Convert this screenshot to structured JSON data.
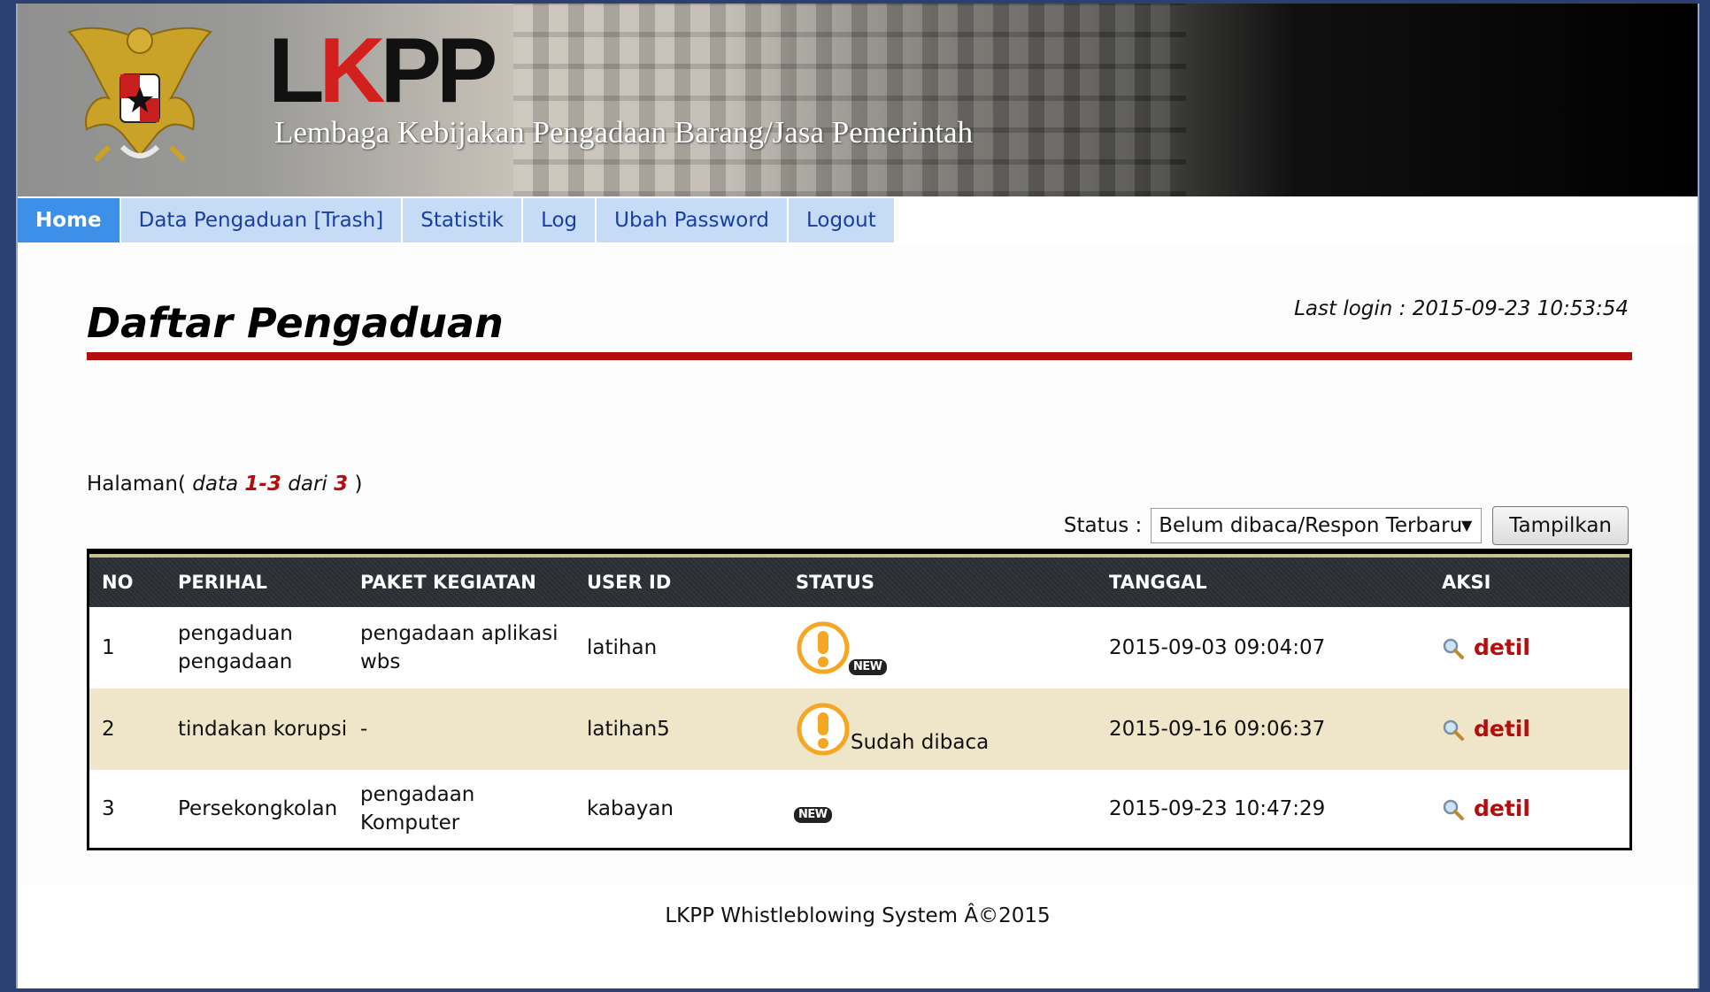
{
  "header": {
    "logo_text_a": "L",
    "logo_text_b": "K",
    "logo_text_c": "PP",
    "subtitle": "Lembaga Kebijakan Pengadaan Barang/Jasa Pemerintah"
  },
  "nav": {
    "items": [
      {
        "label": "Home",
        "active": true
      },
      {
        "label": "Data Pengaduan [Trash]"
      },
      {
        "label": "Statistik"
      },
      {
        "label": "Log"
      },
      {
        "label": "Ubah Password"
      },
      {
        "label": "Logout"
      }
    ]
  },
  "main": {
    "title": "Daftar Pengaduan",
    "last_login": "Last login : 2015-09-23 10:53:54",
    "halaman": {
      "prefix": "Halaman(",
      "data_word": "data",
      "range": "1-3",
      "dari_word": "dari",
      "total": "3",
      "suffix": ")"
    },
    "filter": {
      "label": "Status :",
      "selected": "Belum dibaca/Respon Terbaru",
      "button": "Tampilkan"
    },
    "table": {
      "headers": [
        "NO",
        "PERIHAL",
        "PAKET KEGIATAN",
        "USER ID",
        "STATUS",
        "TANGGAL",
        "AKSI"
      ],
      "rows": [
        {
          "no": "1",
          "perihal": "pengaduan pengadaan",
          "paket": "pengadaan aplikasi wbs",
          "user": "latihan",
          "status_badge": "NEW",
          "status_text": "",
          "tanggal": "2015-09-03 09:04:07",
          "aksi": "detil"
        },
        {
          "no": "2",
          "perihal": "tindakan korupsi",
          "paket": "-",
          "user": "latihan5",
          "status_badge": "",
          "status_text": "Sudah dibaca",
          "tanggal": "2015-09-16 09:06:37",
          "aksi": "detil"
        },
        {
          "no": "3",
          "perihal": "Persekongkolan",
          "paket": "pengadaan Komputer",
          "user": "kabayan",
          "status_badge": "NEW",
          "status_text": "",
          "tanggal": "2015-09-23 10:47:29",
          "aksi": "detil"
        }
      ]
    }
  },
  "footer": {
    "text": "LKPP Whistleblowing System Â©2015"
  },
  "colors": {
    "accent_red": "#b30d0d",
    "nav_active": "#3d8fe8",
    "nav_bg": "#c6dbf6",
    "row_alt": "#efe5c8",
    "warn_orange": "#f5a623"
  }
}
